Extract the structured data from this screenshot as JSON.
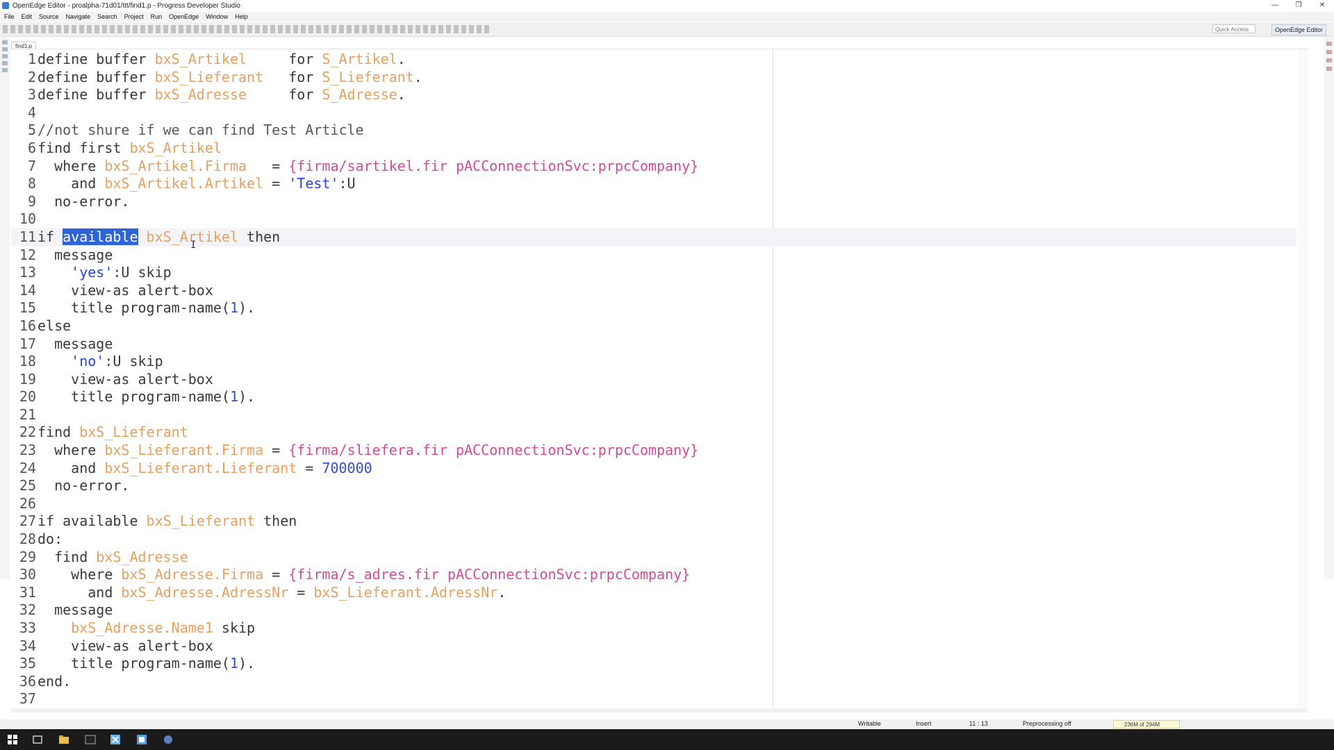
{
  "window": {
    "title": "OpenEdge Editor - proalpha-71d01/ttt/find1.p - Progress Developer Studio",
    "controls": [
      "—",
      "❐",
      "✕"
    ]
  },
  "menu": [
    "File",
    "Edit",
    "Source",
    "Navigate",
    "Search",
    "Project",
    "Run",
    "OpenEdge",
    "Window",
    "Help"
  ],
  "toolbar": {
    "quick_access_placeholder": "Quick Access",
    "perspective": "OpenEdge Editor"
  },
  "editor": {
    "tab_label": "find1.p",
    "highlight_line": 11,
    "lines": [
      [
        [
          "kw",
          "define buffer "
        ],
        [
          "buf",
          "bxS_Artikel"
        ],
        [
          "kw",
          "     for "
        ],
        [
          "buf",
          "S_Artikel"
        ],
        [
          "kw",
          "."
        ]
      ],
      [
        [
          "kw",
          "define buffer "
        ],
        [
          "buf",
          "bxS_Lieferant"
        ],
        [
          "kw",
          "   for "
        ],
        [
          "buf",
          "S_Lieferant"
        ],
        [
          "kw",
          "."
        ]
      ],
      [
        [
          "kw",
          "define buffer "
        ],
        [
          "buf",
          "bxS_Adresse"
        ],
        [
          "kw",
          "     for "
        ],
        [
          "buf",
          "S_Adresse"
        ],
        [
          "kw",
          "."
        ]
      ],
      [],
      [
        [
          "cmt",
          "//not shure if we can find Test Article"
        ]
      ],
      [
        [
          "kw",
          "find first "
        ],
        [
          "buf",
          "bxS_Artikel"
        ]
      ],
      [
        [
          "kw",
          "  where "
        ],
        [
          "buf",
          "bxS_Artikel.Firma"
        ],
        [
          "kw",
          "   = "
        ],
        [
          "pre",
          "{firma/sartikel.fir pACConnectionSvc:prpcCompany}"
        ]
      ],
      [
        [
          "kw",
          "    and "
        ],
        [
          "buf",
          "bxS_Artikel.Artikel"
        ],
        [
          "kw",
          " = "
        ],
        [
          "str",
          "'Test'"
        ],
        [
          "kw",
          ":U"
        ]
      ],
      [
        [
          "kw",
          "  no-error."
        ]
      ],
      [],
      [
        [
          "kw",
          "if "
        ],
        [
          "sel",
          "available"
        ],
        [
          "kw",
          " "
        ],
        [
          "buf",
          "bxS_Artikel"
        ],
        [
          "kw",
          " then"
        ]
      ],
      [
        [
          "kw",
          "  message"
        ]
      ],
      [
        [
          "kw",
          "    "
        ],
        [
          "str",
          "'yes'"
        ],
        [
          "kw",
          ":U skip"
        ]
      ],
      [
        [
          "kw",
          "    view-as alert-box"
        ]
      ],
      [
        [
          "kw",
          "    title program-name("
        ],
        [
          "num",
          "1"
        ],
        [
          "kw",
          ")."
        ]
      ],
      [
        [
          "kw",
          "else"
        ]
      ],
      [
        [
          "kw",
          "  message"
        ]
      ],
      [
        [
          "kw",
          "    "
        ],
        [
          "str",
          "'no'"
        ],
        [
          "kw",
          ":U skip"
        ]
      ],
      [
        [
          "kw",
          "    view-as alert-box"
        ]
      ],
      [
        [
          "kw",
          "    title program-name("
        ],
        [
          "num",
          "1"
        ],
        [
          "kw",
          ")."
        ]
      ],
      [],
      [
        [
          "kw",
          "find "
        ],
        [
          "buf",
          "bxS_Lieferant"
        ]
      ],
      [
        [
          "kw",
          "  where "
        ],
        [
          "buf",
          "bxS_Lieferant.Firma"
        ],
        [
          "kw",
          " = "
        ],
        [
          "pre",
          "{firma/sliefera.fir pACConnectionSvc:prpcCompany}"
        ]
      ],
      [
        [
          "kw",
          "    and "
        ],
        [
          "buf",
          "bxS_Lieferant.Lieferant"
        ],
        [
          "kw",
          " = "
        ],
        [
          "num",
          "700000"
        ]
      ],
      [
        [
          "kw",
          "  no-error."
        ]
      ],
      [],
      [
        [
          "kw",
          "if available "
        ],
        [
          "buf",
          "bxS_Lieferant"
        ],
        [
          "kw",
          " then"
        ]
      ],
      [
        [
          "kw",
          "do:"
        ]
      ],
      [
        [
          "kw",
          "  find "
        ],
        [
          "buf",
          "bxS_Adresse"
        ]
      ],
      [
        [
          "kw",
          "    where "
        ],
        [
          "buf",
          "bxS_Adresse.Firma"
        ],
        [
          "kw",
          " = "
        ],
        [
          "pre",
          "{firma/s_adres.fir pACConnectionSvc:prpcCompany}"
        ]
      ],
      [
        [
          "kw",
          "      and "
        ],
        [
          "buf",
          "bxS_Adresse.AdressNr"
        ],
        [
          "kw",
          " = "
        ],
        [
          "buf",
          "bxS_Lieferant.AdressNr"
        ],
        [
          "kw",
          "."
        ]
      ],
      [
        [
          "kw",
          "  message"
        ]
      ],
      [
        [
          "kw",
          "    "
        ],
        [
          "buf",
          "bxS_Adresse.Name1"
        ],
        [
          "kw",
          " skip"
        ]
      ],
      [
        [
          "kw",
          "    view-as alert-box"
        ]
      ],
      [
        [
          "kw",
          "    title program-name("
        ],
        [
          "num",
          "1"
        ],
        [
          "kw",
          ")."
        ]
      ],
      [
        [
          "kw",
          "end."
        ]
      ],
      []
    ]
  },
  "status": {
    "writable": "Writable",
    "insert": "Insert",
    "position": "11 : 13",
    "preprocessing": "Preprocessing off",
    "memory": "236M of 294M"
  },
  "colors": {
    "keyword": "#3a3a3a",
    "buffer": "#e6a060",
    "string": "#2c44d8",
    "preprocessor": "#d44a9a",
    "selection": "#2f63d8"
  }
}
